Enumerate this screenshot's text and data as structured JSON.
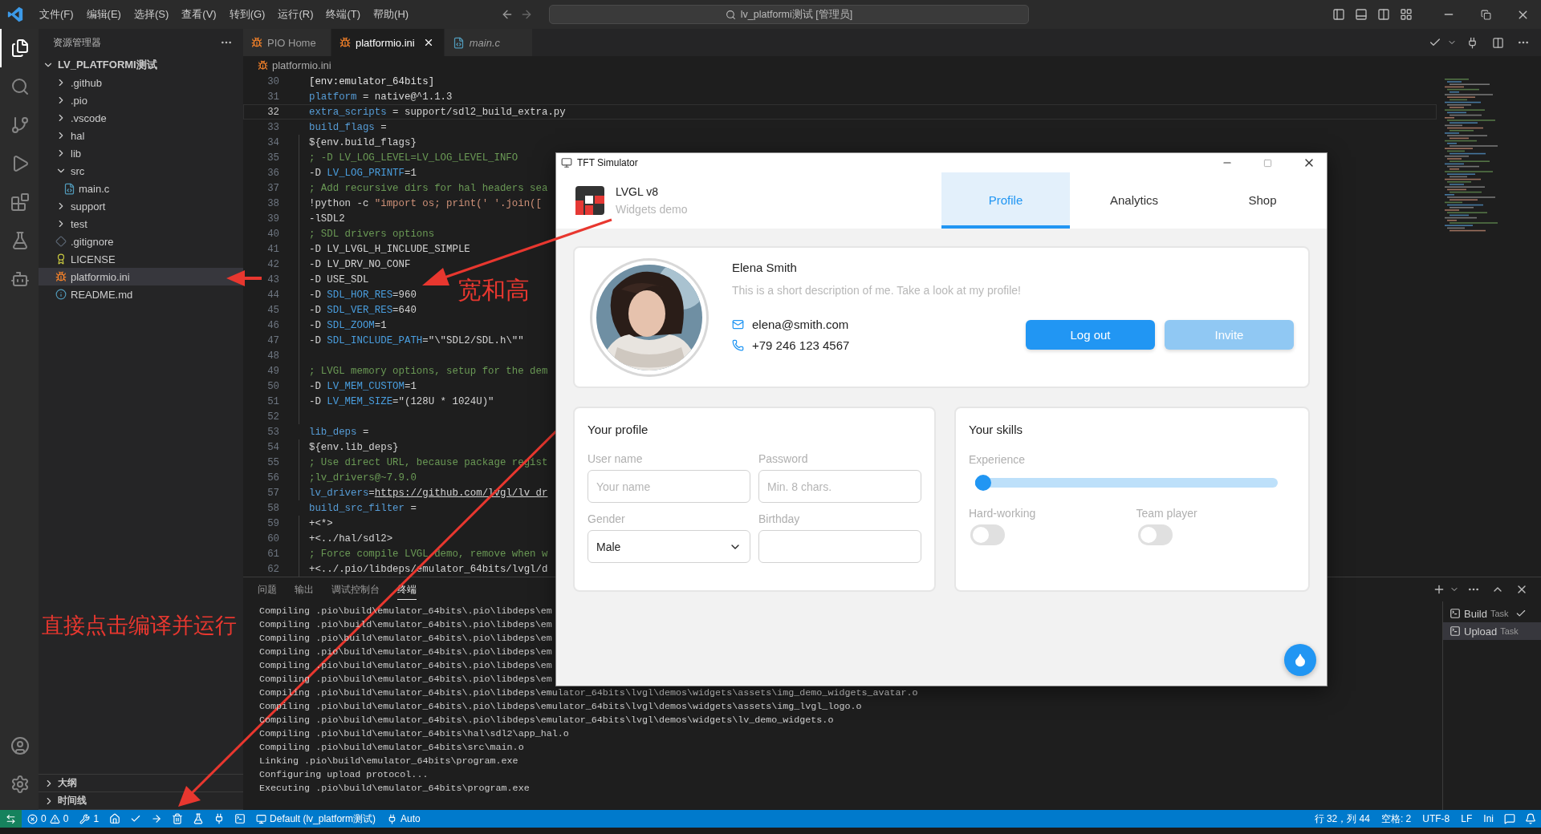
{
  "title_bar": {
    "menus": [
      "文件(F)",
      "编辑(E)",
      "选择(S)",
      "查看(V)",
      "转到(G)",
      "运行(R)",
      "终端(T)",
      "帮助(H)"
    ],
    "search": "lv_platformi测试 [管理员]"
  },
  "sidebar": {
    "title": "资源管理器",
    "root": {
      "label": "LV_PLATFORMI测试",
      "expanded": true
    },
    "items": [
      {
        "label": ".github",
        "kind": "folder",
        "expanded": false,
        "selected": false
      },
      {
        "label": ".pio",
        "kind": "folder",
        "expanded": false,
        "selected": false
      },
      {
        "label": ".vscode",
        "kind": "folder",
        "expanded": false,
        "selected": false
      },
      {
        "label": "hal",
        "kind": "folder",
        "expanded": false,
        "selected": false
      },
      {
        "label": "lib",
        "kind": "folder",
        "expanded": false,
        "selected": false
      },
      {
        "label": "src",
        "kind": "folder",
        "expanded": true,
        "selected": false,
        "children": [
          {
            "label": "main.c",
            "kind": "c",
            "selected": false
          }
        ]
      },
      {
        "label": "support",
        "kind": "folder",
        "expanded": false,
        "selected": false
      },
      {
        "label": "test",
        "kind": "folder",
        "expanded": false,
        "selected": false
      },
      {
        "label": ".gitignore",
        "kind": "git",
        "selected": false
      },
      {
        "label": "LICENSE",
        "kind": "license",
        "selected": false
      },
      {
        "label": "platformio.ini",
        "kind": "pio",
        "selected": true
      },
      {
        "label": "README.md",
        "kind": "info",
        "selected": false
      }
    ],
    "sections": [
      {
        "label": "大纲",
        "expanded": false
      },
      {
        "label": "时间线",
        "expanded": false
      }
    ]
  },
  "editor_tabs": [
    {
      "label": "PIO Home",
      "kind": "pio",
      "selected": false,
      "preview": false
    },
    {
      "label": "platformio.ini",
      "kind": "pio",
      "selected": true,
      "preview": false
    },
    {
      "label": "main.c",
      "kind": "c",
      "selected": false,
      "preview": true
    }
  ],
  "breadcrumb": "platformio.ini",
  "code": [
    {
      "number": "30",
      "current": false,
      "indented": false,
      "tokens": [
        {
          "kind": "section",
          "text": "[env:emulator_64bits]"
        }
      ]
    },
    {
      "number": "31",
      "current": false,
      "indented": false,
      "tokens": [
        {
          "kind": "key",
          "text": "platform"
        },
        {
          "kind": "text",
          "text": " = native@^1.1.3"
        }
      ]
    },
    {
      "number": "32",
      "current": true,
      "indented": false,
      "tokens": [
        {
          "kind": "key",
          "text": "extra_scripts"
        },
        {
          "kind": "text",
          "text": " = support/sdl2_build_extra.py"
        }
      ]
    },
    {
      "number": "33",
      "current": false,
      "indented": false,
      "tokens": [
        {
          "kind": "key",
          "text": "build_flags"
        },
        {
          "kind": "text",
          "text": " ="
        }
      ]
    },
    {
      "number": "34",
      "current": false,
      "indented": true,
      "tokens": [
        {
          "kind": "text",
          "text": "${env.build_flags}"
        }
      ]
    },
    {
      "number": "35",
      "current": false,
      "indented": true,
      "tokens": [
        {
          "kind": "comment",
          "text": "; -D LV_LOG_LEVEL=LV_LOG_LEVEL_INFO"
        }
      ]
    },
    {
      "number": "36",
      "current": false,
      "indented": true,
      "tokens": [
        {
          "kind": "text",
          "text": "-D "
        },
        {
          "kind": "name",
          "text": "LV_LOG_PRINTF"
        },
        {
          "kind": "text",
          "text": "=1"
        }
      ]
    },
    {
      "number": "37",
      "current": false,
      "indented": true,
      "tokens": [
        {
          "kind": "comment",
          "text": "; Add recursive dirs for hal headers sea"
        }
      ]
    },
    {
      "number": "38",
      "current": false,
      "indented": true,
      "tokens": [
        {
          "kind": "text",
          "text": "!python -c "
        },
        {
          "kind": "string",
          "text": "\"import os; print(' '.join(["
        }
      ]
    },
    {
      "number": "39",
      "current": false,
      "indented": true,
      "tokens": [
        {
          "kind": "text",
          "text": "-lSDL2"
        }
      ]
    },
    {
      "number": "40",
      "current": false,
      "indented": true,
      "tokens": [
        {
          "kind": "comment",
          "text": "; SDL drivers options"
        }
      ]
    },
    {
      "number": "41",
      "current": false,
      "indented": true,
      "tokens": [
        {
          "kind": "text",
          "text": "-D LV_LVGL_H_INCLUDE_SIMPLE"
        }
      ]
    },
    {
      "number": "42",
      "current": false,
      "indented": true,
      "tokens": [
        {
          "kind": "text",
          "text": "-D LV_DRV_NO_CONF"
        }
      ]
    },
    {
      "number": "43",
      "current": false,
      "indented": true,
      "tokens": [
        {
          "kind": "text",
          "text": "-D USE_SDL"
        }
      ]
    },
    {
      "number": "44",
      "current": false,
      "indented": true,
      "tokens": [
        {
          "kind": "text",
          "text": "-D "
        },
        {
          "kind": "name",
          "text": "SDL_HOR_RES"
        },
        {
          "kind": "text",
          "text": "=960"
        }
      ]
    },
    {
      "number": "45",
      "current": false,
      "indented": true,
      "tokens": [
        {
          "kind": "text",
          "text": "-D "
        },
        {
          "kind": "name",
          "text": "SDL_VER_RES"
        },
        {
          "kind": "text",
          "text": "=640"
        }
      ]
    },
    {
      "number": "46",
      "current": false,
      "indented": true,
      "tokens": [
        {
          "kind": "text",
          "text": "-D "
        },
        {
          "kind": "name",
          "text": "SDL_ZOOM"
        },
        {
          "kind": "text",
          "text": "=1"
        }
      ]
    },
    {
      "number": "47",
      "current": false,
      "indented": true,
      "tokens": [
        {
          "kind": "text",
          "text": "-D "
        },
        {
          "kind": "name",
          "text": "SDL_INCLUDE_PATH"
        },
        {
          "kind": "text",
          "text": "=\"\\\"SDL2/SDL.h\\\"\""
        }
      ]
    },
    {
      "number": "48",
      "current": false,
      "indented": true
    },
    {
      "number": "49",
      "current": false,
      "indented": true,
      "tokens": [
        {
          "kind": "comment",
          "text": "; LVGL memory options, setup for the dem"
        }
      ]
    },
    {
      "number": "50",
      "current": false,
      "indented": true,
      "tokens": [
        {
          "kind": "text",
          "text": "-D "
        },
        {
          "kind": "name",
          "text": "LV_MEM_CUSTOM"
        },
        {
          "kind": "text",
          "text": "=1"
        }
      ]
    },
    {
      "number": "51",
      "current": false,
      "indented": true,
      "tokens": [
        {
          "kind": "text",
          "text": "-D "
        },
        {
          "kind": "name",
          "text": "LV_MEM_SIZE"
        },
        {
          "kind": "text",
          "text": "=\"(128U * 1024U)\""
        }
      ]
    },
    {
      "number": "52",
      "current": false,
      "indented": true
    },
    {
      "number": "53",
      "current": false,
      "indented": false,
      "tokens": [
        {
          "kind": "key",
          "text": "lib_deps"
        },
        {
          "kind": "text",
          "text": " ="
        }
      ]
    },
    {
      "number": "54",
      "current": false,
      "indented": true,
      "tokens": [
        {
          "kind": "text",
          "text": "${env.lib_deps}"
        }
      ]
    },
    {
      "number": "55",
      "current": false,
      "indented": true,
      "tokens": [
        {
          "kind": "comment",
          "text": "; Use direct URL, because package regist"
        }
      ]
    },
    {
      "number": "56",
      "current": false,
      "indented": true,
      "tokens": [
        {
          "kind": "comment",
          "text": ";lv_drivers@~7.9.0"
        }
      ]
    },
    {
      "number": "57",
      "current": false,
      "indented": true,
      "tokens": [
        {
          "kind": "key",
          "text": "lv_drivers"
        },
        {
          "kind": "text",
          "text": "="
        },
        {
          "kind": "link",
          "text": "https://github.com/lvgl/lv_dr"
        }
      ]
    },
    {
      "number": "58",
      "current": false,
      "indented": false,
      "tokens": [
        {
          "kind": "key",
          "text": "build_src_filter"
        },
        {
          "kind": "text",
          "text": " ="
        }
      ]
    },
    {
      "number": "59",
      "current": false,
      "indented": true,
      "tokens": [
        {
          "kind": "text",
          "text": "+<*>"
        }
      ]
    },
    {
      "number": "60",
      "current": false,
      "indented": true,
      "tokens": [
        {
          "kind": "text",
          "text": "+<../hal/sdl2>"
        }
      ]
    },
    {
      "number": "61",
      "current": false,
      "indented": true,
      "tokens": [
        {
          "kind": "comment",
          "text": "; Force compile LVGL demo, remove when w"
        }
      ]
    },
    {
      "number": "62",
      "current": false,
      "indented": true,
      "tokens": [
        {
          "kind": "text",
          "text": "+<../.pio/libdeps/emulator_64bits/lvgl/d"
        }
      ]
    }
  ],
  "panel": {
    "tabs": [
      {
        "label": "问题",
        "selected": false
      },
      {
        "label": "输出",
        "selected": false
      },
      {
        "label": "调试控制台",
        "selected": false
      },
      {
        "label": "终端",
        "selected": true
      }
    ],
    "terminal_lines": [
      "Compiling .pio\\build\\emulator_64bits\\.pio\\libdeps\\em",
      "Compiling .pio\\build\\emulator_64bits\\.pio\\libdeps\\em",
      "Compiling .pio\\build\\emulator_64bits\\.pio\\libdeps\\em",
      "Compiling .pio\\build\\emulator_64bits\\.pio\\libdeps\\em",
      "Compiling .pio\\build\\emulator_64bits\\.pio\\libdeps\\em",
      "Compiling .pio\\build\\emulator_64bits\\.pio\\libdeps\\em",
      "Compiling .pio\\build\\emulator_64bits\\.pio\\libdeps\\emulator_64bits\\lvgl\\demos\\widgets\\assets\\img_demo_widgets_avatar.o",
      "Compiling .pio\\build\\emulator_64bits\\.pio\\libdeps\\emulator_64bits\\lvgl\\demos\\widgets\\assets\\img_lvgl_logo.o",
      "Compiling .pio\\build\\emulator_64bits\\.pio\\libdeps\\emulator_64bits\\lvgl\\demos\\widgets\\lv_demo_widgets.o",
      "Compiling .pio\\build\\emulator_64bits\\hal\\sdl2\\app_hal.o",
      "Compiling .pio\\build\\emulator_64bits\\src\\main.o",
      "Linking .pio\\build\\emulator_64bits\\program.exe",
      "Configuring upload protocol...",
      "Executing .pio\\build\\emulator_64bits\\program.exe"
    ],
    "tasks": [
      {
        "label": "Build",
        "detail": "Task",
        "done": true,
        "selected": false
      },
      {
        "label": "Upload",
        "detail": "Task",
        "done": false,
        "selected": true
      }
    ]
  },
  "status_bar": {
    "errors": "0",
    "warnings": "0",
    "tasks": "1",
    "project": "Default (lv_platform测试)",
    "env": "Auto",
    "position": "行 32，列 44",
    "indent": "空格: 2",
    "encoding": "UTF-8",
    "eol": "LF",
    "language": "Ini"
  },
  "simulator": {
    "title": "TFT Simulator",
    "app_title": "LVGL v8",
    "app_subtitle": "Widgets demo",
    "tabs": [
      {
        "label": "Profile",
        "selected": true
      },
      {
        "label": "Analytics",
        "selected": false
      },
      {
        "label": "Shop",
        "selected": false
      }
    ],
    "profile": {
      "name": "Elena Smith",
      "description": "This is a short description of me. Take a look at my profile!",
      "email": "elena@smith.com",
      "phone": "+79 246 123 4567",
      "buttons": [
        {
          "label": "Log out",
          "kind": "primary"
        },
        {
          "label": "Invite",
          "kind": "secondary"
        }
      ]
    },
    "your_profile": {
      "title": "Your profile",
      "fields": [
        {
          "label": "User name",
          "kind": "text",
          "placeholder": "Your name"
        },
        {
          "label": "Password",
          "kind": "text",
          "placeholder": "Min. 8 chars."
        },
        {
          "label": "Gender",
          "kind": "dropdown",
          "value": "Male"
        },
        {
          "label": "Birthday",
          "kind": "text"
        }
      ]
    },
    "your_skills": {
      "title": "Your skills",
      "slider": {
        "label": "Experience",
        "level": 0
      },
      "switches": [
        {
          "label": "Hard-working",
          "on": false
        },
        {
          "label": "Team player",
          "on": false
        }
      ]
    }
  },
  "annotations": [
    {
      "text": "宽和高"
    },
    {
      "text": "直接点击编译并运行"
    }
  ]
}
